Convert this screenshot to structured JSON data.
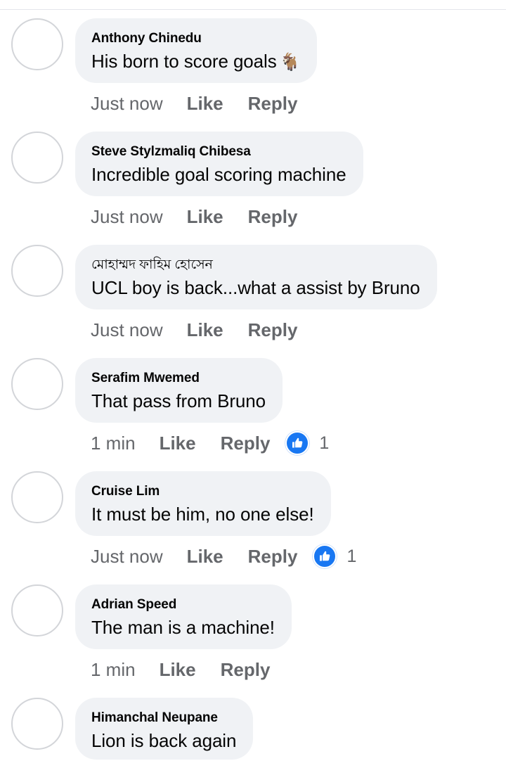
{
  "colors": {
    "bubble": "#f0f2f5",
    "meta_text": "#65676b",
    "like_blue": "#1877f2"
  },
  "actions": {
    "like_label": "Like",
    "reply_label": "Reply"
  },
  "comments": [
    {
      "author": "Anthony Chinedu",
      "text": "His born to score goals",
      "emoji": "🐐",
      "time": "Just now",
      "reaction_count": null
    },
    {
      "author": "Steve Stylzmaliq Chibesa",
      "text": "Incredible goal scoring machine",
      "time": "Just now",
      "reaction_count": null
    },
    {
      "author": "মোহাম্মদ ফাহিম হোসেন",
      "text": "UCL boy is back...what a assist by Bruno",
      "time": "Just now",
      "reaction_count": null
    },
    {
      "author": "Serafim Mwemed",
      "text": "That pass from Bruno",
      "time": "1 min",
      "reaction_count": "1",
      "reaction_icon": "thumbs-up-icon"
    },
    {
      "author": "Cruise Lim",
      "text": "It must be him, no one else!",
      "time": "Just now",
      "reaction_count": "1",
      "reaction_icon": "thumbs-up-icon"
    },
    {
      "author": "Adrian Speed",
      "text": "The man is a machine!",
      "time": "1 min",
      "reaction_count": null
    },
    {
      "author": "Himanchal Neupane",
      "text": "Lion is back again",
      "time": null,
      "reaction_count": null
    }
  ]
}
